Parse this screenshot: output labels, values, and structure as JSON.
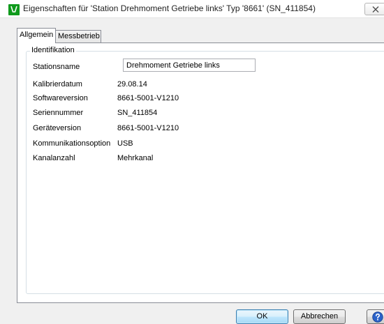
{
  "window": {
    "title": "Eigenschaften für 'Station Drehmoment Getriebe links' Typ '8661'  (SN_411854)",
    "icon": "app-icon",
    "accent_color": "#0f9a1c"
  },
  "tabs": [
    {
      "label": "Allgemein",
      "selected": true
    },
    {
      "label": "Messbetrieb",
      "selected": false
    }
  ],
  "identification": {
    "group_title": "Identifikation",
    "rows": [
      {
        "label": "Stationsname",
        "value": "Drehmoment Getriebe links",
        "editable": true
      },
      {
        "label": "Kalibrierdatum",
        "value": "29.08.14"
      },
      {
        "label": "Softwareversion",
        "value": "8661-5001-V1210"
      },
      {
        "label": "Seriennummer",
        "value": "SN_411854"
      },
      {
        "label": "Geräteversion",
        "value": "8661-5001-V1210"
      },
      {
        "label": "Kommunikationsoption",
        "value": "USB"
      },
      {
        "label": "Kanalanzahl",
        "value": "Mehrkanal"
      }
    ]
  },
  "buttons": {
    "ok": "OK",
    "cancel": "Abbrechen",
    "help_icon": "help-icon"
  }
}
